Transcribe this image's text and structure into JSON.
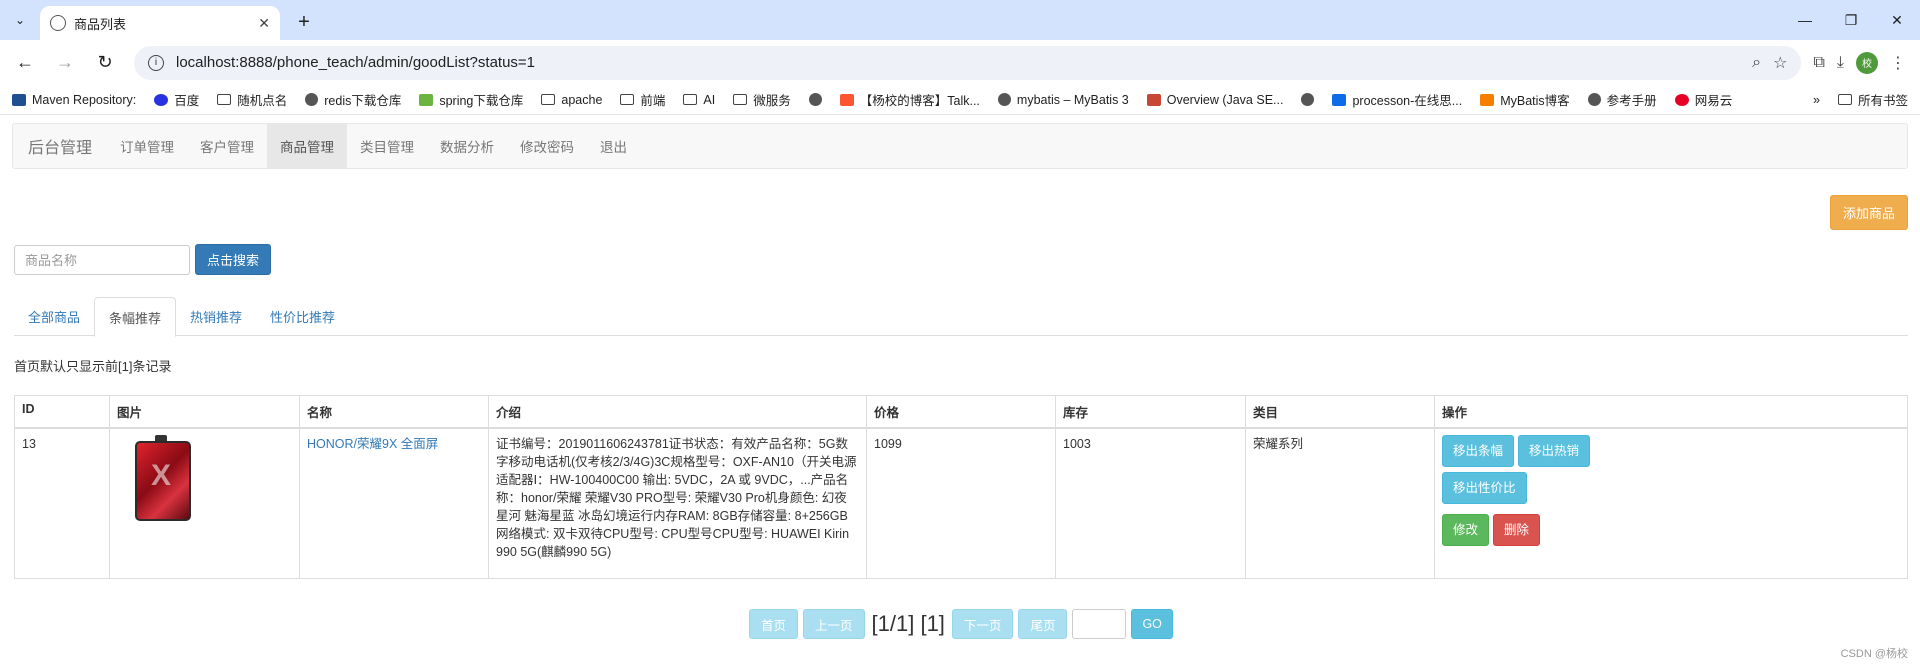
{
  "browser": {
    "tab_title": "商品列表",
    "url": "localhost:8888/phone_teach/admin/goodList?status=1",
    "avatar_text": "校",
    "bookmarks": [
      {
        "label": "Maven Repository:",
        "icon": "maven-icon"
      },
      {
        "label": "百度",
        "icon": "baidu-icon"
      },
      {
        "label": "随机点名",
        "icon": "folder-icon"
      },
      {
        "label": "redis下载仓库",
        "icon": "globe-icon"
      },
      {
        "label": "spring下载仓库",
        "icon": "spring-icon"
      },
      {
        "label": "apache",
        "icon": "folder-icon"
      },
      {
        "label": "前端",
        "icon": "folder-icon"
      },
      {
        "label": "AI",
        "icon": "folder-icon"
      },
      {
        "label": "微服务",
        "icon": "folder-icon"
      },
      {
        "label": "",
        "icon": "globe-icon"
      },
      {
        "label": "【杨校的博客】Talk...",
        "icon": "csdn-icon"
      },
      {
        "label": "mybatis – MyBatis 3",
        "icon": "globe-icon"
      },
      {
        "label": "Overview (Java SE...",
        "icon": "oracle-icon"
      },
      {
        "label": "",
        "icon": "globe-icon"
      },
      {
        "label": "processon-在线思...",
        "icon": "processon-icon"
      },
      {
        "label": "MyBatis博客",
        "icon": "blogger-icon"
      },
      {
        "label": "参考手册",
        "icon": "globe-icon"
      },
      {
        "label": "网易云",
        "icon": "netease-icon"
      }
    ],
    "all_bookmarks": "所有书签",
    "more": "»"
  },
  "nav": {
    "brand": "后台管理",
    "items": [
      {
        "label": "订单管理",
        "active": false
      },
      {
        "label": "客户管理",
        "active": false
      },
      {
        "label": "商品管理",
        "active": true
      },
      {
        "label": "类目管理",
        "active": false
      },
      {
        "label": "数据分析",
        "active": false
      },
      {
        "label": "修改密码",
        "active": false
      },
      {
        "label": "退出",
        "active": false
      }
    ]
  },
  "actions": {
    "add_product": "添加商品",
    "search_placeholder": "商品名称",
    "search_button": "点击搜索"
  },
  "tabs": [
    {
      "label": "全部商品",
      "active": false
    },
    {
      "label": "条幅推荐",
      "active": true
    },
    {
      "label": "热销推荐",
      "active": false
    },
    {
      "label": "性价比推荐",
      "active": false
    }
  ],
  "note": "首页默认只显示前[1]条记录",
  "table": {
    "headers": [
      "ID",
      "图片",
      "名称",
      "介绍",
      "价格",
      "库存",
      "类目",
      "操作"
    ],
    "rows": [
      {
        "id": "13",
        "image": "phone-image",
        "name": "HONOR/荣耀9X 全面屏",
        "intro": "证书编号：2019011606243781证书状态：有效产品名称：5G数字移动电话机(仅考核2/3/4G)3C规格型号：OXF-AN10（开关电源适配器Ⅰ：HW-100400C00 输出: 5VDC，2A 或 9VDC，...产品名称：honor/荣耀 荣耀V30 PRO型号: 荣耀V30 Pro机身颜色: 幻夜星河 魅海星蓝 冰岛幻境运行内存RAM: 8GB存储容量: 8+256GB网络模式: 双卡双待CPU型号: CPU型号CPU型号: HUAWEI Kirin 990 5G(麒麟990 5G)",
        "price": "1099",
        "stock": "1003",
        "category": "荣耀系列",
        "ops": {
          "remove_banner": "移出条幅",
          "remove_hot": "移出热销",
          "remove_value": "移出性价比",
          "edit": "修改",
          "delete": "删除"
        }
      }
    ]
  },
  "pager": {
    "first": "首页",
    "prev": "上一页",
    "info": "[1/1] [1]",
    "next": "下一页",
    "last": "尾页",
    "go": "GO"
  },
  "watermark": "CSDN @杨校"
}
